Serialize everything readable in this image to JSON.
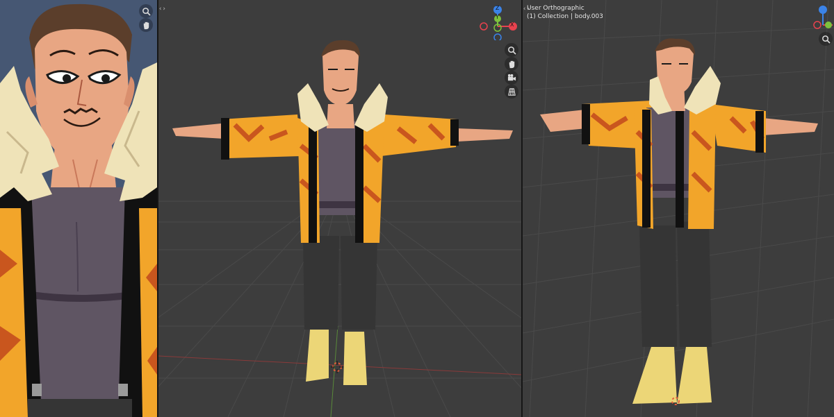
{
  "viewports": {
    "left": {
      "name": "camera-closeup-viewport"
    },
    "middle": {
      "name": "front-viewport"
    },
    "right": {
      "name": "user-orthographic-viewport",
      "view_label": "User Orthographic",
      "collection_label": "(1) Collection | body.003"
    }
  },
  "gizmo": {
    "axis_colors": {
      "x": "#e8424e",
      "y": "#7dc13d",
      "z": "#3b83e8"
    },
    "axis_labels": {
      "x": "X",
      "y": "Y",
      "z": "Z"
    }
  },
  "icons": [
    "zoom-icon",
    "hand-pan-icon",
    "camera-icon",
    "grid-icon",
    "collapse-arrow-icon",
    "3d-cursor-icon"
  ],
  "character": {
    "jacket_colors": {
      "base": "#f2a52a",
      "stripe": "#c9561e",
      "trim": "#111111"
    },
    "fur_color": "#efe3b8",
    "shirt_color": "#5f5563",
    "pants_color": "#353535",
    "boots_color": "#ecd677",
    "skin_color": "#e8a683",
    "hair_color": "#5b3e2b"
  }
}
